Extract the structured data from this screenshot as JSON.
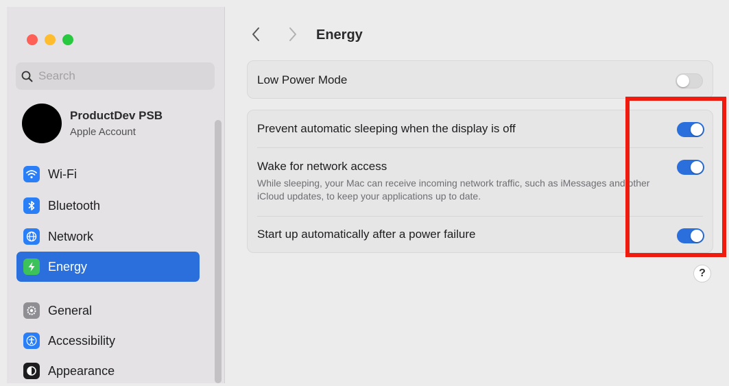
{
  "window": {
    "title": "Energy"
  },
  "sidebar": {
    "search": {
      "placeholder": "Search",
      "value": ""
    },
    "account": {
      "name": "ProductDev PSB",
      "subtitle": "Apple Account"
    },
    "items": [
      {
        "label": "Wi-Fi",
        "icon": "wifi-icon",
        "color": "#2a7ef6",
        "selected": false
      },
      {
        "label": "Bluetooth",
        "icon": "bluetooth-icon",
        "color": "#2a7ef6",
        "selected": false
      },
      {
        "label": "Network",
        "icon": "globe-icon",
        "color": "#2a7ef6",
        "selected": false
      },
      {
        "label": "Energy",
        "icon": "bolt-icon",
        "color": "#3dc15a",
        "selected": true
      },
      {
        "label": "General",
        "icon": "gear-icon",
        "color": "#8e8e93",
        "selected": false
      },
      {
        "label": "Accessibility",
        "icon": "accessibility-icon",
        "color": "#2a7ef6",
        "selected": false
      },
      {
        "label": "Appearance",
        "icon": "appearance-icon",
        "color": "#1d1d1f",
        "selected": false
      }
    ]
  },
  "main": {
    "title": "Energy",
    "low_power": {
      "label": "Low Power Mode",
      "on": false
    },
    "settings": [
      {
        "label": "Prevent automatic sleeping when the display is off",
        "on": true
      },
      {
        "label": "Wake for network access",
        "desc": "While sleeping, your Mac can receive incoming network traffic, such as iMessages and other iCloud updates, to keep your applications up to date.",
        "on": true
      },
      {
        "label": "Start up automatically after a power failure",
        "on": true
      }
    ],
    "help_label": "?"
  },
  "colors": {
    "accent": "#2a6fdb",
    "highlight": "#ef1b0f",
    "traffic_close": "#fe5f57",
    "traffic_min": "#febc2e",
    "traffic_max": "#28c840"
  }
}
